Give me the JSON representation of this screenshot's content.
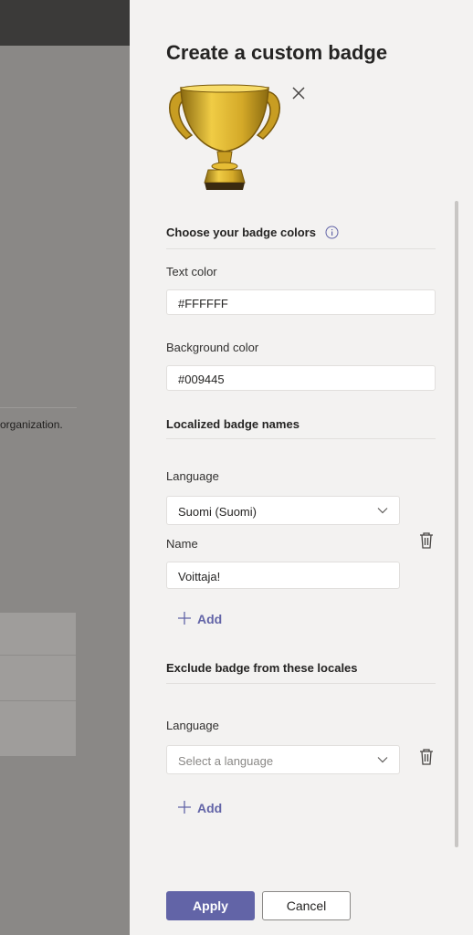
{
  "background": {
    "text": "organization."
  },
  "panel": {
    "title": "Create a custom badge",
    "colors": {
      "heading": "Choose your badge colors",
      "text_color_label": "Text color",
      "text_color_value": "#FFFFFF",
      "background_color_label": "Background color",
      "background_color_value": "#009445"
    },
    "localized": {
      "heading": "Localized badge names",
      "language_label": "Language",
      "language_value": "Suomi (Suomi)",
      "name_label": "Name",
      "name_value": "Voittaja!",
      "add_label": "Add"
    },
    "exclude": {
      "heading": "Exclude badge from these locales",
      "language_label": "Language",
      "language_placeholder": "Select a language",
      "add_label": "Add"
    },
    "buttons": {
      "apply": "Apply",
      "cancel": "Cancel"
    }
  },
  "icons": [
    "trophy-image",
    "close-icon",
    "info-icon",
    "chevron-down-icon",
    "trash-icon",
    "plus-icon"
  ],
  "theme": {
    "accent": "#6264a7",
    "panel_bg": "#f3f2f1",
    "overlay": "#8a8886"
  }
}
